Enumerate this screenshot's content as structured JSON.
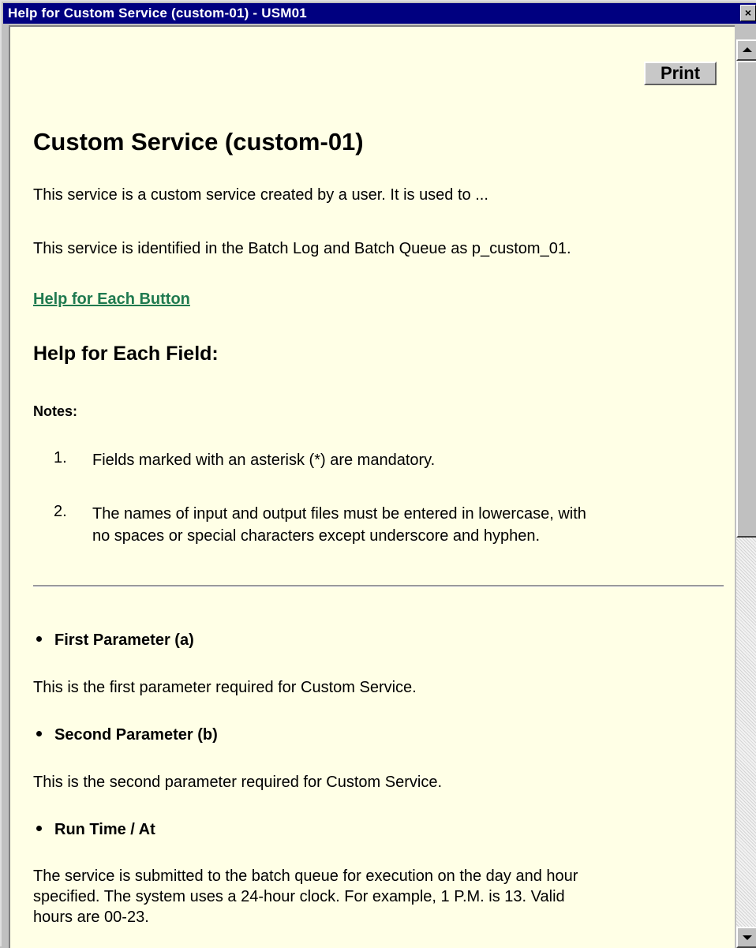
{
  "window": {
    "title": "Help for Custom Service (custom-01) - USM01",
    "close_label": "×"
  },
  "toolbar": {
    "print_label": "Print"
  },
  "doc": {
    "heading": "Custom Service (custom-01)",
    "intro": "This service is a custom service created by a user. It is used to ...",
    "identified": "This service is identified in the Batch Log and Batch Queue as p_custom_01.",
    "button_help_link": "Help for Each Button",
    "field_help_heading": "Help for Each Field:",
    "notes_label": "Notes:",
    "notes": [
      {
        "num": "1.",
        "lines": [
          "Fields marked with an asterisk (*) are mandatory."
        ]
      },
      {
        "num": "2.",
        "lines": [
          "The names of input and output files must be entered in lowercase, with",
          "no spaces or special characters except underscore and hyphen."
        ]
      }
    ],
    "fields": [
      {
        "name": "First Parameter (a)",
        "desc": "This is the first parameter required for Custom Service."
      },
      {
        "name": "Second Parameter (b)",
        "desc": "This is the second parameter required for Custom Service."
      },
      {
        "name": "Run Time / At",
        "desc_lines": [
          "The service is submitted to the batch queue for execution on the day and hour",
          "specified. The system uses a 24-hour clock. For example, 1 P.M. is 13. Valid",
          "hours are 00-23."
        ]
      }
    ]
  },
  "colors": {
    "titlebar": "#000080",
    "page_bg": "#ffffe6",
    "link": "#1f7a4f"
  }
}
